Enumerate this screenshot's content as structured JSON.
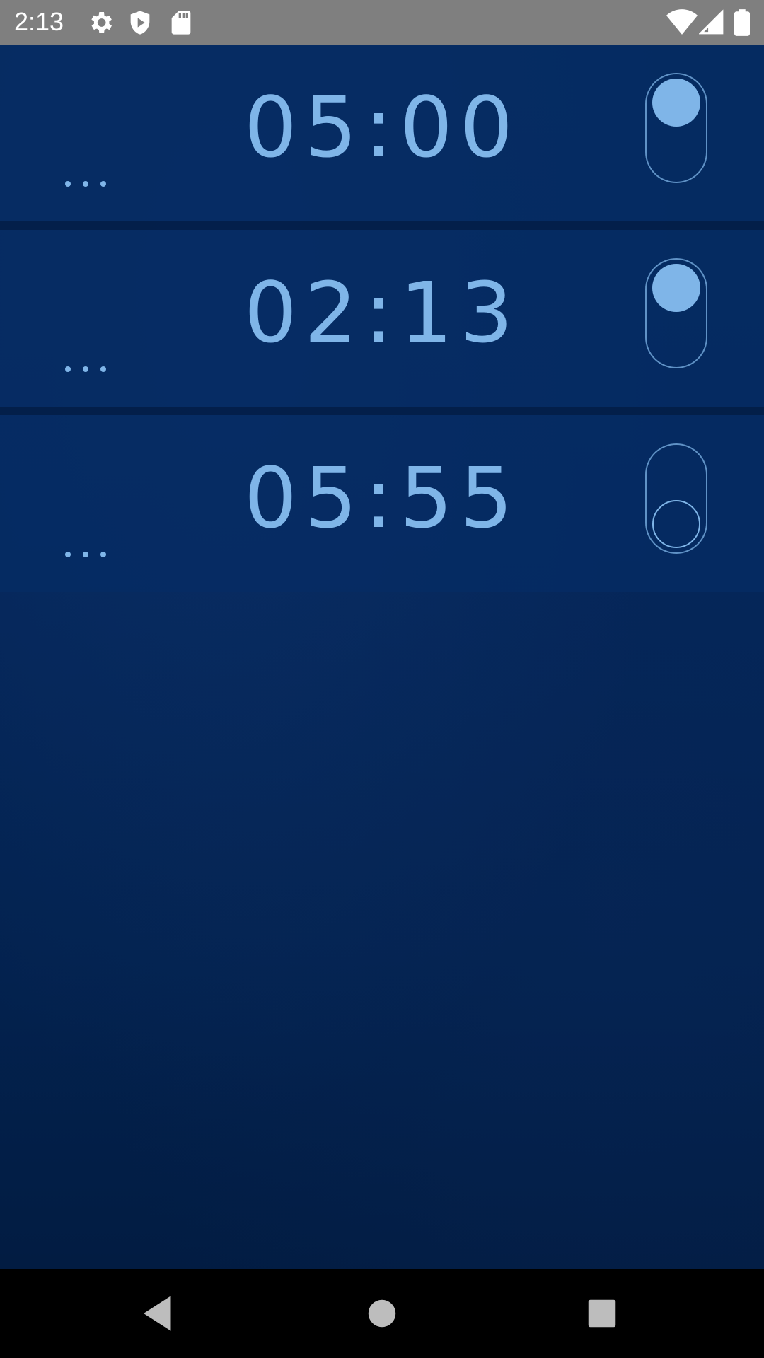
{
  "status_bar": {
    "time": "2:13",
    "left_icons": [
      "gear-icon",
      "shield-icon",
      "sd-card-icon"
    ],
    "right_icons": [
      "wifi-icon",
      "signal-icon",
      "battery-icon"
    ]
  },
  "alarms": [
    {
      "time": "05:00",
      "enabled": true,
      "menu_label": "..."
    },
    {
      "time": "02:13",
      "enabled": true,
      "menu_label": "..."
    },
    {
      "time": "05:55",
      "enabled": false,
      "menu_label": "..."
    }
  ],
  "nav_bar": {
    "buttons": [
      "back-icon",
      "home-icon",
      "recents-icon"
    ]
  },
  "colors": {
    "accent": "#7fb5e8",
    "background": "#04265a",
    "status_bar": "#7f7f7f"
  }
}
